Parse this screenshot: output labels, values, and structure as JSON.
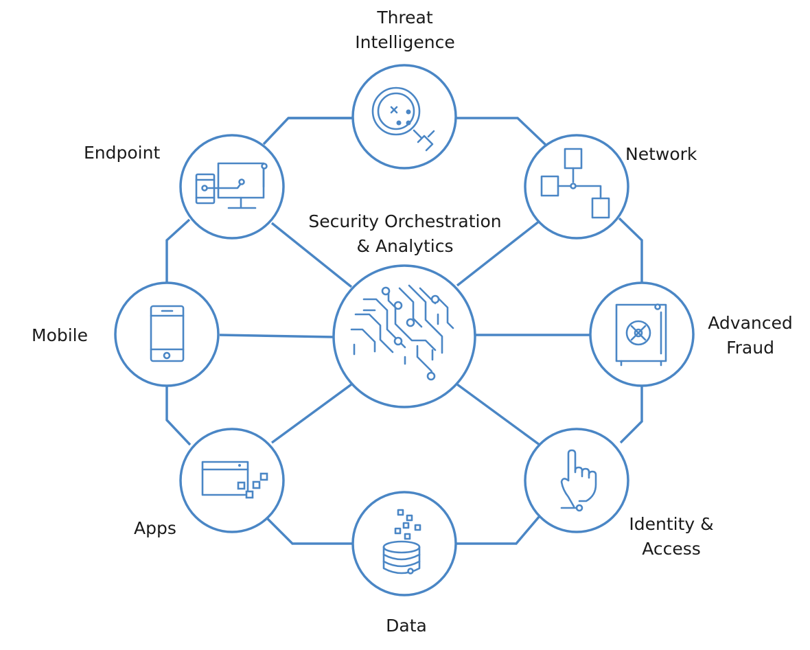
{
  "colors": {
    "accent": "#4a86c5",
    "text": "#1a1a1a",
    "background": "#ffffff"
  },
  "center": {
    "label_line1": "Security Orchestration",
    "label_line2": "& Analytics",
    "icon": "brain-circuit-icon"
  },
  "nodes": {
    "threat_intelligence": {
      "line1": "Threat",
      "line2": "Intelligence",
      "icon": "magnifier-threat-icon"
    },
    "network": {
      "line1": "Network",
      "icon": "network-nodes-icon"
    },
    "advanced_fraud": {
      "line1": "Advanced",
      "line2": "Fraud",
      "icon": "safe-vault-icon"
    },
    "identity_access": {
      "line1": "Identity &",
      "line2": "Access",
      "icon": "finger-touch-icon"
    },
    "data": {
      "line1": "Data",
      "icon": "database-icon"
    },
    "apps": {
      "line1": "Apps",
      "icon": "app-window-icon"
    },
    "mobile": {
      "line1": "Mobile",
      "icon": "mobile-phone-icon"
    },
    "endpoint": {
      "line1": "Endpoint",
      "icon": "devices-icon"
    }
  }
}
